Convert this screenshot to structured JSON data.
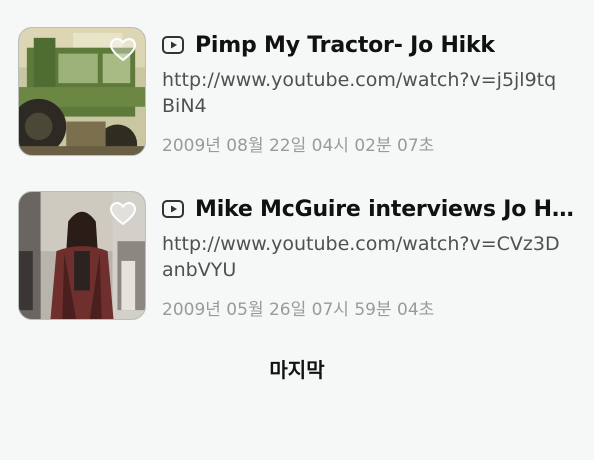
{
  "videos": [
    {
      "title": "Pimp My Tractor- Jo Hikk",
      "url": "http://www.youtube.com/watch?v=j5jl9tqBiN4",
      "date": "2009년 08월 22일 04시 02분 07초",
      "thumbnail": "tractor-thumbnail"
    },
    {
      "title": "Mike McGuire interviews Jo Hikk",
      "url": "http://www.youtube.com/watch?v=CVz3DanbVYU",
      "date": "2009년 05월 26일 07시 59분 04초",
      "thumbnail": "person-street-thumbnail"
    }
  ],
  "footer": {
    "label": "마지막"
  },
  "icons": {
    "play": "play-icon",
    "favorite": "heart-icon"
  },
  "colors": {
    "background": "#f5f8f6",
    "title": "#111111",
    "url": "#505050",
    "date": "#9a9a9a"
  }
}
